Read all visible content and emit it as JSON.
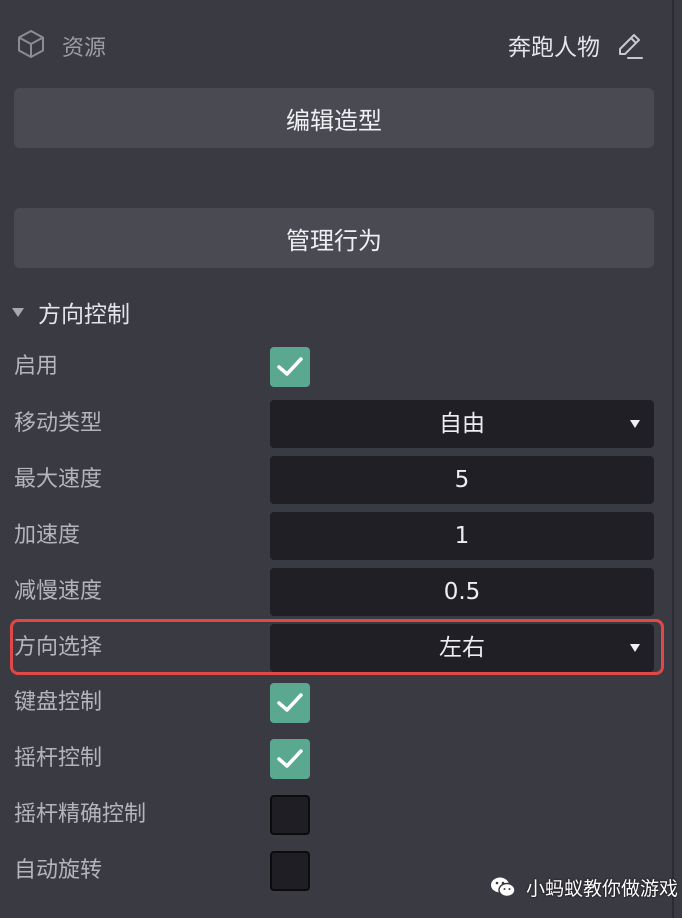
{
  "header": {
    "label": "资源",
    "object_name": "奔跑人物",
    "icon": "cube-icon",
    "edit_icon": "pencil-icon"
  },
  "buttons": {
    "edit_shape": "编辑造型",
    "manage_behavior": "管理行为"
  },
  "section": {
    "title": "方向控制",
    "expanded": true
  },
  "properties": {
    "enable": {
      "label": "启用",
      "checked": true
    },
    "move_type": {
      "label": "移动类型",
      "value": "自由"
    },
    "max_speed": {
      "label": "最大速度",
      "value": "5"
    },
    "acceleration": {
      "label": "加速度",
      "value": "1"
    },
    "deceleration": {
      "label": "减慢速度",
      "value": "0.5"
    },
    "direction": {
      "label": "方向选择",
      "value": "左右"
    },
    "keyboard_control": {
      "label": "键盘控制",
      "checked": true
    },
    "joystick_control": {
      "label": "摇杆控制",
      "checked": true
    },
    "joystick_precise": {
      "label": "摇杆精确控制",
      "checked": false
    },
    "auto_rotate": {
      "label": "自动旋转",
      "checked": false
    }
  },
  "colors": {
    "panel_bg": "#3a3a43",
    "button_bg": "#4a4a53",
    "field_bg": "#1f1f25",
    "checkbox_checked": "#5aa88f",
    "highlight": "#e04747"
  },
  "watermark": {
    "text": "小蚂蚁教你做游戏",
    "icon": "wechat-icon"
  }
}
